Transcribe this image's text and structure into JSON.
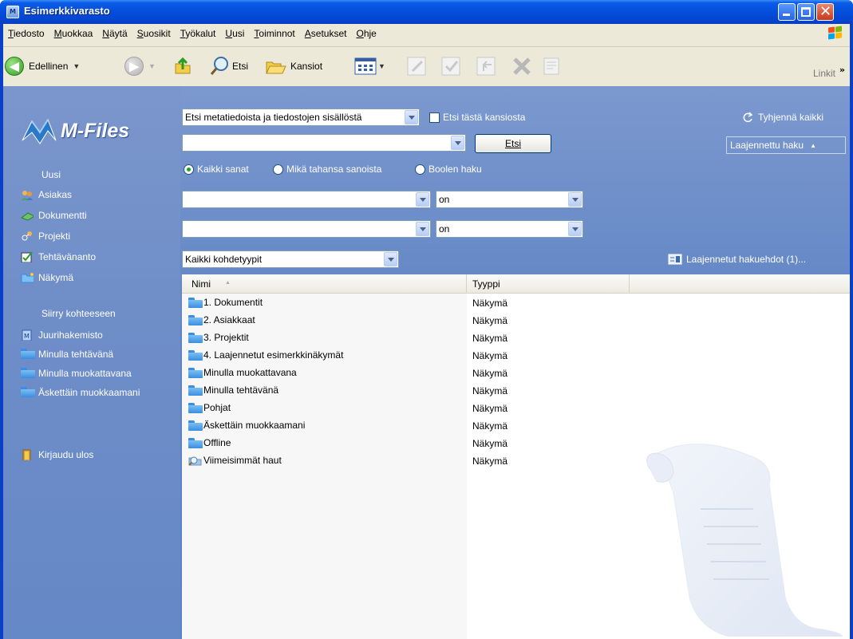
{
  "window": {
    "title": "Esimerkkivarasto",
    "app_icon_letter": "M"
  },
  "menubar": {
    "items": [
      "Tiedosto",
      "Muokkaa",
      "Näytä",
      "Suosikit",
      "Työkalut",
      "Uusi",
      "Toiminnot",
      "Asetukset",
      "Ohje"
    ]
  },
  "toolbar": {
    "back_label": "Edellinen",
    "search_label": "Etsi",
    "folders_label": "Kansiot",
    "links_label": "Linkit",
    "more_chevron": "»"
  },
  "sidebar": {
    "logo_text": "M-Files",
    "new_heading": "Uusi",
    "new_items": [
      {
        "label": "Asiakas",
        "icon": "customer-icon"
      },
      {
        "label": "Dokumentti",
        "icon": "document-icon"
      },
      {
        "label": "Projekti",
        "icon": "project-icon"
      },
      {
        "label": "Tehtävänanto",
        "icon": "assignment-icon"
      },
      {
        "label": "Näkymä",
        "icon": "view-icon"
      }
    ],
    "goto_heading": "Siirry kohteeseen",
    "goto_items": [
      {
        "label": "Juurihakemisto",
        "icon": "vault-icon"
      },
      {
        "label": "Minulla tehtävänä",
        "icon": "folder-icon"
      },
      {
        "label": "Minulla muokattavana",
        "icon": "folder-icon"
      },
      {
        "label": "Äskettäin muokkaamani",
        "icon": "folder-icon"
      }
    ],
    "logout_label": "Kirjaudu ulos"
  },
  "search": {
    "scope_value": "Etsi metatiedoista ja tiedostojen sisällöstä",
    "this_folder_label": "Etsi tästä kansiosta",
    "this_folder_checked": false,
    "query_value": "",
    "search_button": "Etsi",
    "clear_all": "Tyhjennä kaikki",
    "advanced_toggle": "Laajennettu haku",
    "radio_options": [
      {
        "label": "Kaikki sanat",
        "selected": true
      },
      {
        "label": "Mikä tahansa sanoista",
        "selected": false
      },
      {
        "label": "Boolen haku",
        "selected": false
      }
    ],
    "conditions": [
      {
        "property": "",
        "operator": "on",
        "value": ""
      },
      {
        "property": "",
        "operator": "on",
        "value": ""
      }
    ],
    "object_type": "Kaikki kohdetyypit",
    "advanced_conditions_link": "Laajennetut hakuehdot (1)..."
  },
  "list": {
    "columns": [
      "Nimi",
      "Tyyppi"
    ],
    "rows": [
      {
        "name": "1. Dokumentit",
        "type": "Näkymä",
        "icon": "folder-icon"
      },
      {
        "name": "2. Asiakkaat",
        "type": "Näkymä",
        "icon": "folder-icon"
      },
      {
        "name": "3. Projektit",
        "type": "Näkymä",
        "icon": "folder-icon"
      },
      {
        "name": "4. Laajennetut esimerkkinäkymät",
        "type": "Näkymä",
        "icon": "folder-icon"
      },
      {
        "name": "Minulla muokattavana",
        "type": "Näkymä",
        "icon": "folder-icon"
      },
      {
        "name": "Minulla tehtävänä",
        "type": "Näkymä",
        "icon": "folder-icon"
      },
      {
        "name": "Pohjat",
        "type": "Näkymä",
        "icon": "folder-icon"
      },
      {
        "name": "Äskettäin muokkaamani",
        "type": "Näkymä",
        "icon": "folder-icon"
      },
      {
        "name": "Offline",
        "type": "Näkymä",
        "icon": "folder-icon"
      },
      {
        "name": "Viimeisimmät haut",
        "type": "Näkymä",
        "icon": "saved-search-icon"
      }
    ]
  },
  "colors": {
    "titlebar": "#0551de",
    "sidebar": "#6f8ec8",
    "window_border": "#0a3fc7"
  }
}
